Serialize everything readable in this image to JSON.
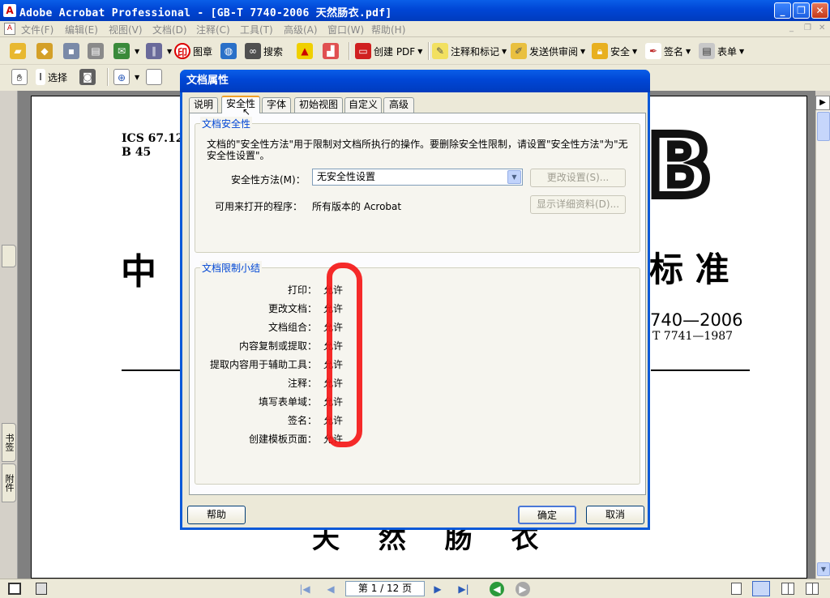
{
  "window": {
    "title": "Adobe Acrobat Professional - [GB-T 7740-2006 天然肠衣.pdf]",
    "controls": {
      "minimize": "_",
      "restore": "❐",
      "close": "✕"
    }
  },
  "menubar": {
    "items": [
      "文件(F)",
      "编辑(E)",
      "视图(V)",
      "文档(D)",
      "注释(C)",
      "工具(T)",
      "高级(A)",
      "窗口(W)",
      "帮助(H)"
    ]
  },
  "toolbar1": {
    "stamp": "图章",
    "search": "搜索",
    "create_pdf": "创建 PDF",
    "comment_markup": "注释和标记",
    "send_review": "发送供审阅",
    "security": "安全",
    "sign": "签名",
    "forms": "表单"
  },
  "toolbar2": {
    "select": "选择"
  },
  "left_tabs": [
    "书签",
    "附件"
  ],
  "document": {
    "ics": "ICS 67.12",
    "code": "B 45",
    "logo": "B",
    "heading_left": "中",
    "heading_right": "标 准",
    "std_number": "740—2006",
    "replaces": "T 7741—1987",
    "bottom_title": "天 然 肠 衣"
  },
  "dialog": {
    "title": "文档属性",
    "tabs": [
      "说明",
      "安全性",
      "字体",
      "初始视图",
      "自定义",
      "高级"
    ],
    "active_tab": "安全性",
    "security_group": {
      "label": "文档安全性",
      "description_line1": "文档的\"安全性方法\"用于限制对文档所执行的操作。要删除安全性限制，请设置\"安全性方法\"为\"无",
      "description_line2": "安全性设置\"。",
      "method_label": "安全性方法(M)：",
      "method_value": "无安全性设置",
      "change_settings_button": "更改设置(S)...",
      "openable_label": "可用来打开的程序：",
      "openable_value": "所有版本的 Acrobat",
      "show_details_button": "显示详细资料(D)..."
    },
    "restrictions_group": {
      "label": "文档限制小结",
      "items": [
        {
          "label": "打印：",
          "value": "允许"
        },
        {
          "label": "更改文档：",
          "value": "允许"
        },
        {
          "label": "文档组合：",
          "value": "允许"
        },
        {
          "label": "内容复制或提取：",
          "value": "允许"
        },
        {
          "label": "提取内容用于辅助工具：",
          "value": "允许"
        },
        {
          "label": "注释：",
          "value": "允许"
        },
        {
          "label": "填写表单域：",
          "value": "允许"
        },
        {
          "label": "签名：",
          "value": "允许"
        },
        {
          "label": "创建模板页面：",
          "value": "允许"
        }
      ]
    },
    "help_button": "帮助",
    "ok_button": "确定",
    "cancel_button": "取消"
  },
  "statusbar": {
    "page_display": "第 1 / 12 页"
  },
  "colors": {
    "xp_blue": "#0046d5",
    "dialog_face": "#ece9d8",
    "highlight_red": "#f41818"
  }
}
